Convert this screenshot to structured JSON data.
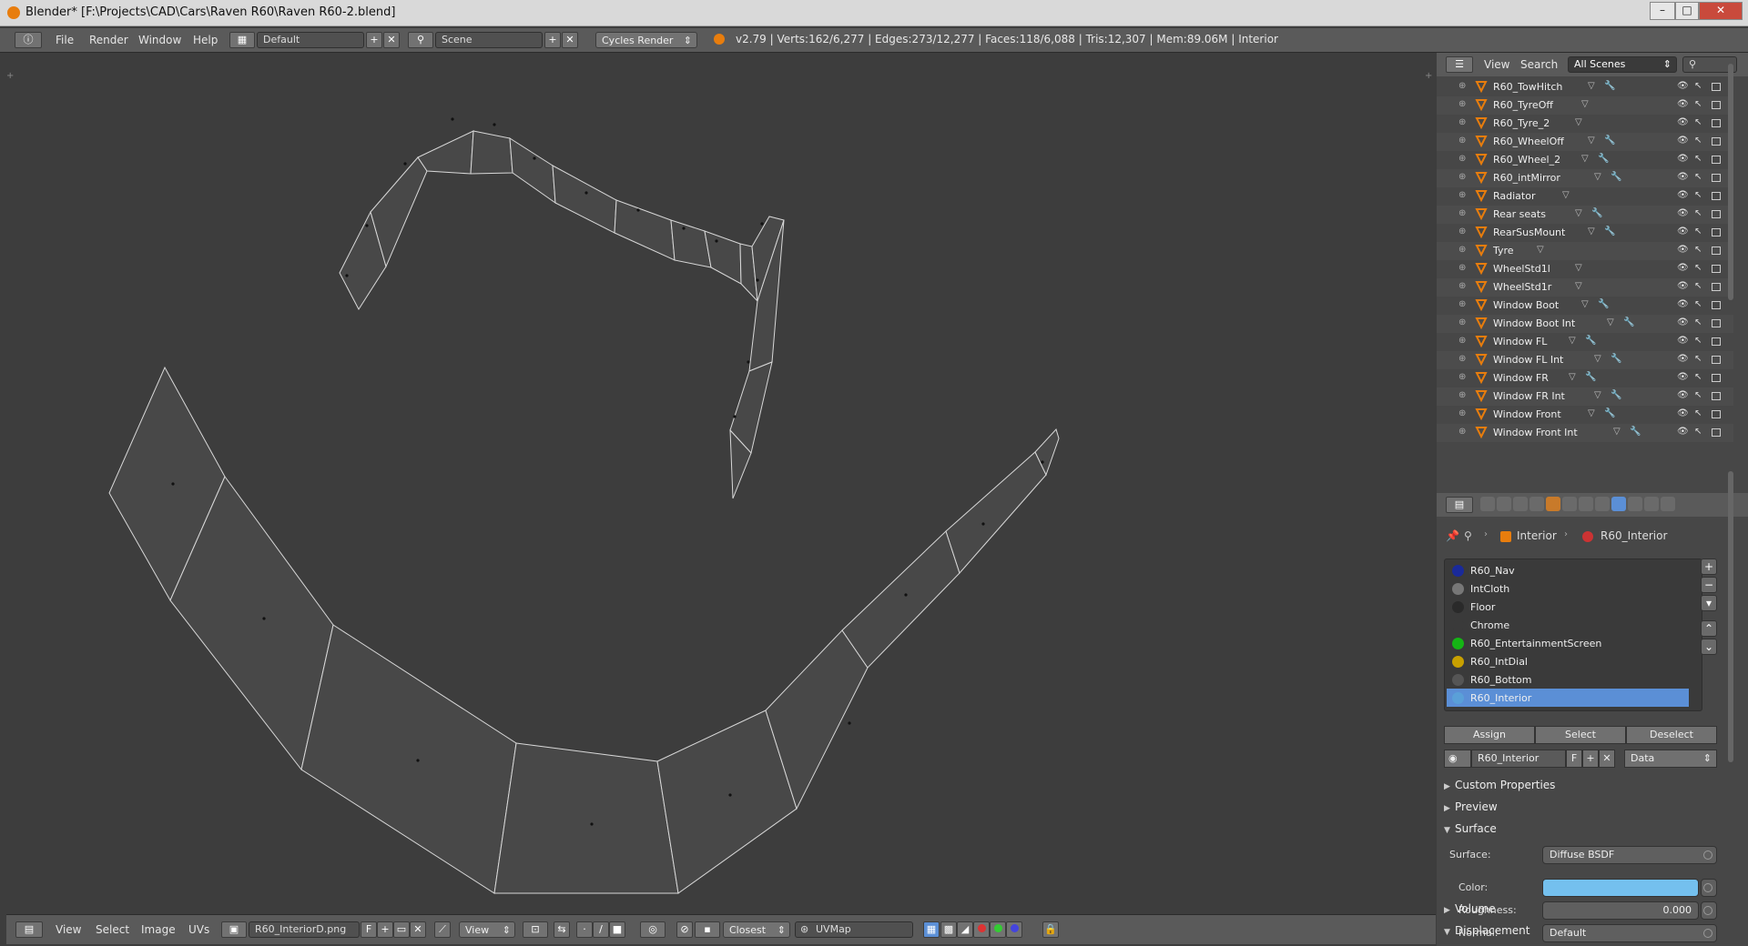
{
  "window": {
    "title": "Blender* [F:\\Projects\\CAD\\Cars\\Raven R60\\Raven R60-2.blend]",
    "controls": {
      "minimize": "–",
      "maximize": "□",
      "close": "✕"
    }
  },
  "info_header": {
    "menus": [
      "File",
      "Render",
      "Window",
      "Help"
    ],
    "screen_layout": "Default",
    "scene": "Scene",
    "render_engine": "Cycles Render",
    "stats": "v2.79 | Verts:162/6,277 | Edges:273/12,277 | Faces:118/6,088 | Tris:12,307 | Mem:89.06M | Interior"
  },
  "uv_header": {
    "menus": [
      "View",
      "Select",
      "Image",
      "UVs"
    ],
    "image_name": "R60_InteriorD.png",
    "fake_user": "F",
    "view_menu": "View",
    "sample_mode": "Closest",
    "uv_map": "UVMap"
  },
  "outliner": {
    "header_view": "View",
    "header_search": "Search",
    "scene_filter": "All Scenes",
    "items": [
      {
        "name": "R60_TowHitch",
        "modifier": true
      },
      {
        "name": "R60_TyreOff",
        "modifier": false
      },
      {
        "name": "R60_Tyre_2",
        "modifier": false
      },
      {
        "name": "R60_WheelOff",
        "modifier": true
      },
      {
        "name": "R60_Wheel_2",
        "modifier": true
      },
      {
        "name": "R60_intMirror",
        "modifier": true
      },
      {
        "name": "Radiator",
        "modifier": false
      },
      {
        "name": "Rear seats",
        "modifier": true
      },
      {
        "name": "RearSusMount",
        "modifier": true
      },
      {
        "name": "Tyre",
        "modifier": false
      },
      {
        "name": "WheelStd1l",
        "modifier": false
      },
      {
        "name": "WheelStd1r",
        "modifier": false
      },
      {
        "name": "Window Boot",
        "modifier": true
      },
      {
        "name": "Window Boot Int",
        "modifier": true
      },
      {
        "name": "Window FL",
        "modifier": true
      },
      {
        "name": "Window FL Int",
        "modifier": true
      },
      {
        "name": "Window FR",
        "modifier": true
      },
      {
        "name": "Window FR Int",
        "modifier": true
      },
      {
        "name": "Window Front",
        "modifier": true
      },
      {
        "name": "Window Front Int",
        "modifier": true
      }
    ]
  },
  "properties": {
    "breadcrumb": [
      "Interior",
      "R60_Interior"
    ],
    "materials": [
      {
        "name": "R60_Nav",
        "color": "#1a2a9a"
      },
      {
        "name": "IntCloth",
        "color": "#777777"
      },
      {
        "name": "Floor",
        "color": "#2a2a2a"
      },
      {
        "name": "Chrome",
        "color": "#3a3a3a"
      },
      {
        "name": "R60_EntertainmentScreen",
        "color": "#15b515"
      },
      {
        "name": "R60_IntDial",
        "color": "#c8a000"
      },
      {
        "name": "R60_Bottom",
        "color": "#555555"
      },
      {
        "name": "R60_Interior",
        "color": "#5aa0d8"
      }
    ],
    "selected_material": "R60_Interior",
    "buttons": {
      "assign": "Assign",
      "select": "Select",
      "deselect": "Deselect"
    },
    "material_field": "R60_Interior",
    "fake_user": "F",
    "link": "Data",
    "panels": {
      "custom_properties": "Custom Properties",
      "preview": "Preview",
      "surface": "Surface",
      "volume": "Volume",
      "displacement": "Displacement"
    },
    "surface": {
      "surface_label": "Surface:",
      "surface_value": "Diffuse BSDF",
      "color_label": "Color:",
      "color_value": "#74c0ee",
      "roughness_label": "Roughness:",
      "roughness_value": "0.000",
      "normal_label": "Normal:",
      "normal_value": "Default"
    }
  },
  "colors": {
    "accent": "#5b8fd6",
    "header": "#5a5a5a",
    "viewport": "#3d3d3d",
    "object_icon": "#e87d0d"
  }
}
